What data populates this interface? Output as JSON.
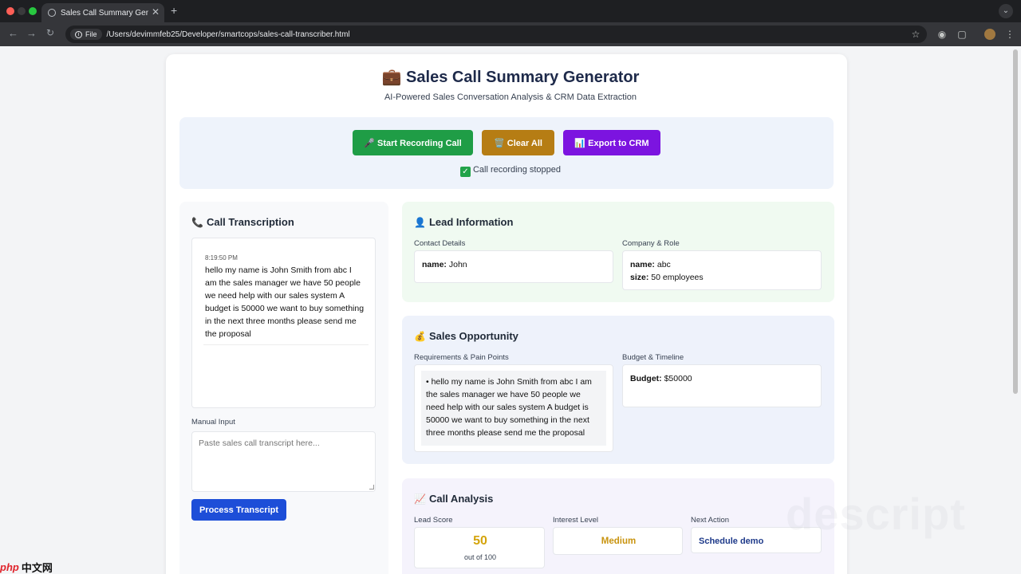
{
  "browser": {
    "tab_title": "Sales Call Summary Generator",
    "file_chip": "File",
    "url": "/Users/devimmfeb25/Developer/smartcops/sales-call-transcriber.html",
    "new_tab": "+",
    "close": "✕"
  },
  "header": {
    "icon": "💼",
    "title": "Sales Call Summary Generator",
    "subtitle": "AI-Powered Sales Conversation Analysis & CRM Data Extraction"
  },
  "controls": {
    "start_label": "🎤 Start Recording Call",
    "clear_label": "🗑️ Clear All",
    "export_label": "📊 Export to CRM",
    "status": "Call recording stopped"
  },
  "transcription": {
    "title": "Call Transcription",
    "timestamp": "8:19:50 PM",
    "text": "hello my name is John Smith from abc I am the sales manager we have 50 people we need help with our sales system A budget is 50000 we want to buy something in the next three months please send me the proposal",
    "manual_label": "Manual Input",
    "manual_placeholder": "Paste sales call transcript here...",
    "process_label": "Process Transcript"
  },
  "lead": {
    "title": "Lead Information",
    "contact_label": "Contact Details",
    "contact_name_key": "name:",
    "contact_name_val": " John",
    "company_label": "Company & Role",
    "company_name_key": "name:",
    "company_name_val": " abc",
    "company_size_key": "size:",
    "company_size_val": " 50 employees"
  },
  "opportunity": {
    "title": "Sales Opportunity",
    "req_label": "Requirements & Pain Points",
    "req_text": "• hello my name is John Smith from abc I am the sales manager we have 50 people we need help with our sales system A budget is 50000 we want to buy something in the next three months please send me the proposal",
    "budget_label": "Budget & Timeline",
    "budget_key": "Budget:",
    "budget_val": " $50000"
  },
  "analysis": {
    "title": "Call Analysis",
    "score_label": "Lead Score",
    "score_value": "50",
    "score_suffix": "out of 100",
    "interest_label": "Interest Level",
    "interest_value": "Medium",
    "next_label": "Next Action",
    "next_value": "Schedule demo"
  },
  "watermark": "descript",
  "badge": {
    "php": "php",
    "cn": "中文网"
  },
  "colors": {
    "start": "#1f9d46",
    "clear": "#b67d14",
    "export": "#7c14e0",
    "process": "#1d4ed8",
    "score": "#d4a40c",
    "interest": "#c99410",
    "next": "#1e3a8a"
  }
}
